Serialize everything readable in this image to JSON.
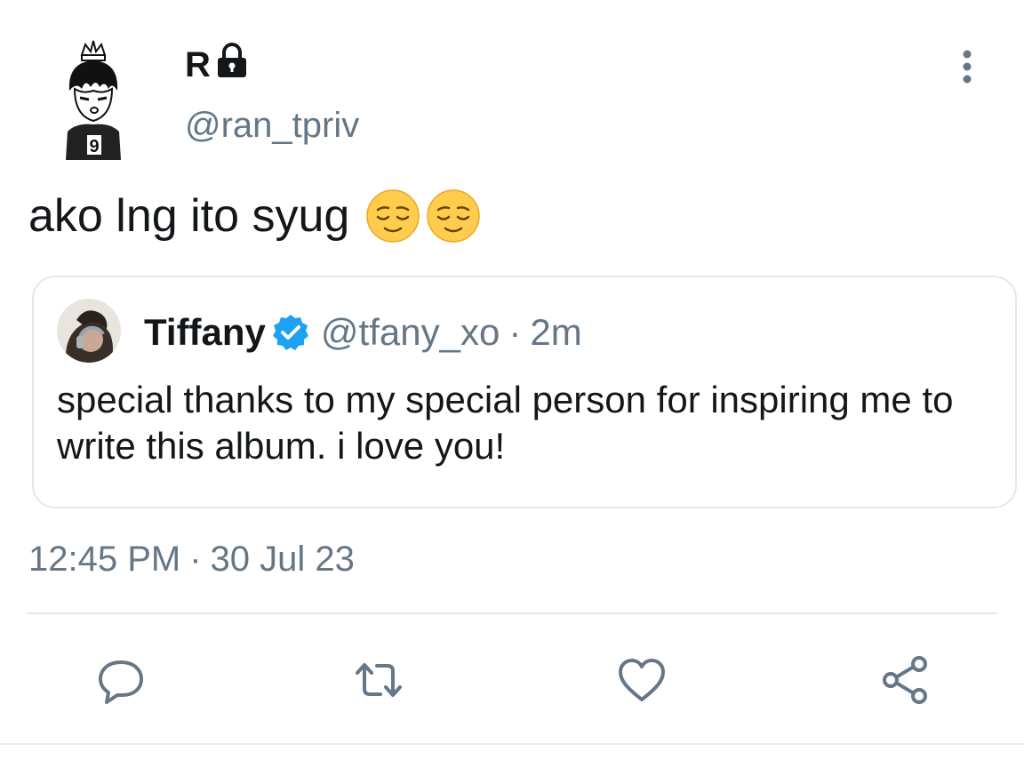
{
  "author": {
    "display_name": "R",
    "handle": "@ran_tpriv",
    "avatar_icon": "anime-character-avatar",
    "protected_icon": "lock-icon"
  },
  "tweet": {
    "text": "ako lng ito syug",
    "emojis": [
      "relieved-face-emoji",
      "relieved-face-emoji"
    ]
  },
  "quoted_tweet": {
    "display_name": "Tiffany",
    "verified_icon": "verified-badge-icon",
    "handle": "@tfany_xo",
    "separator": "·",
    "time": "2m",
    "text": "special thanks to my special person for inspiring me to write this album. i love you!"
  },
  "timestamp": {
    "time": "12:45 PM",
    "separator": "·",
    "date": "30 Jul 23"
  },
  "actions": [
    "reply-icon",
    "retweet-icon",
    "like-icon",
    "share-icon"
  ],
  "colors": {
    "text": "#14171a",
    "secondary": "#657786",
    "border": "#e1e8ed",
    "verified": "#1da1f2",
    "emoji": "#ffcc4d"
  }
}
